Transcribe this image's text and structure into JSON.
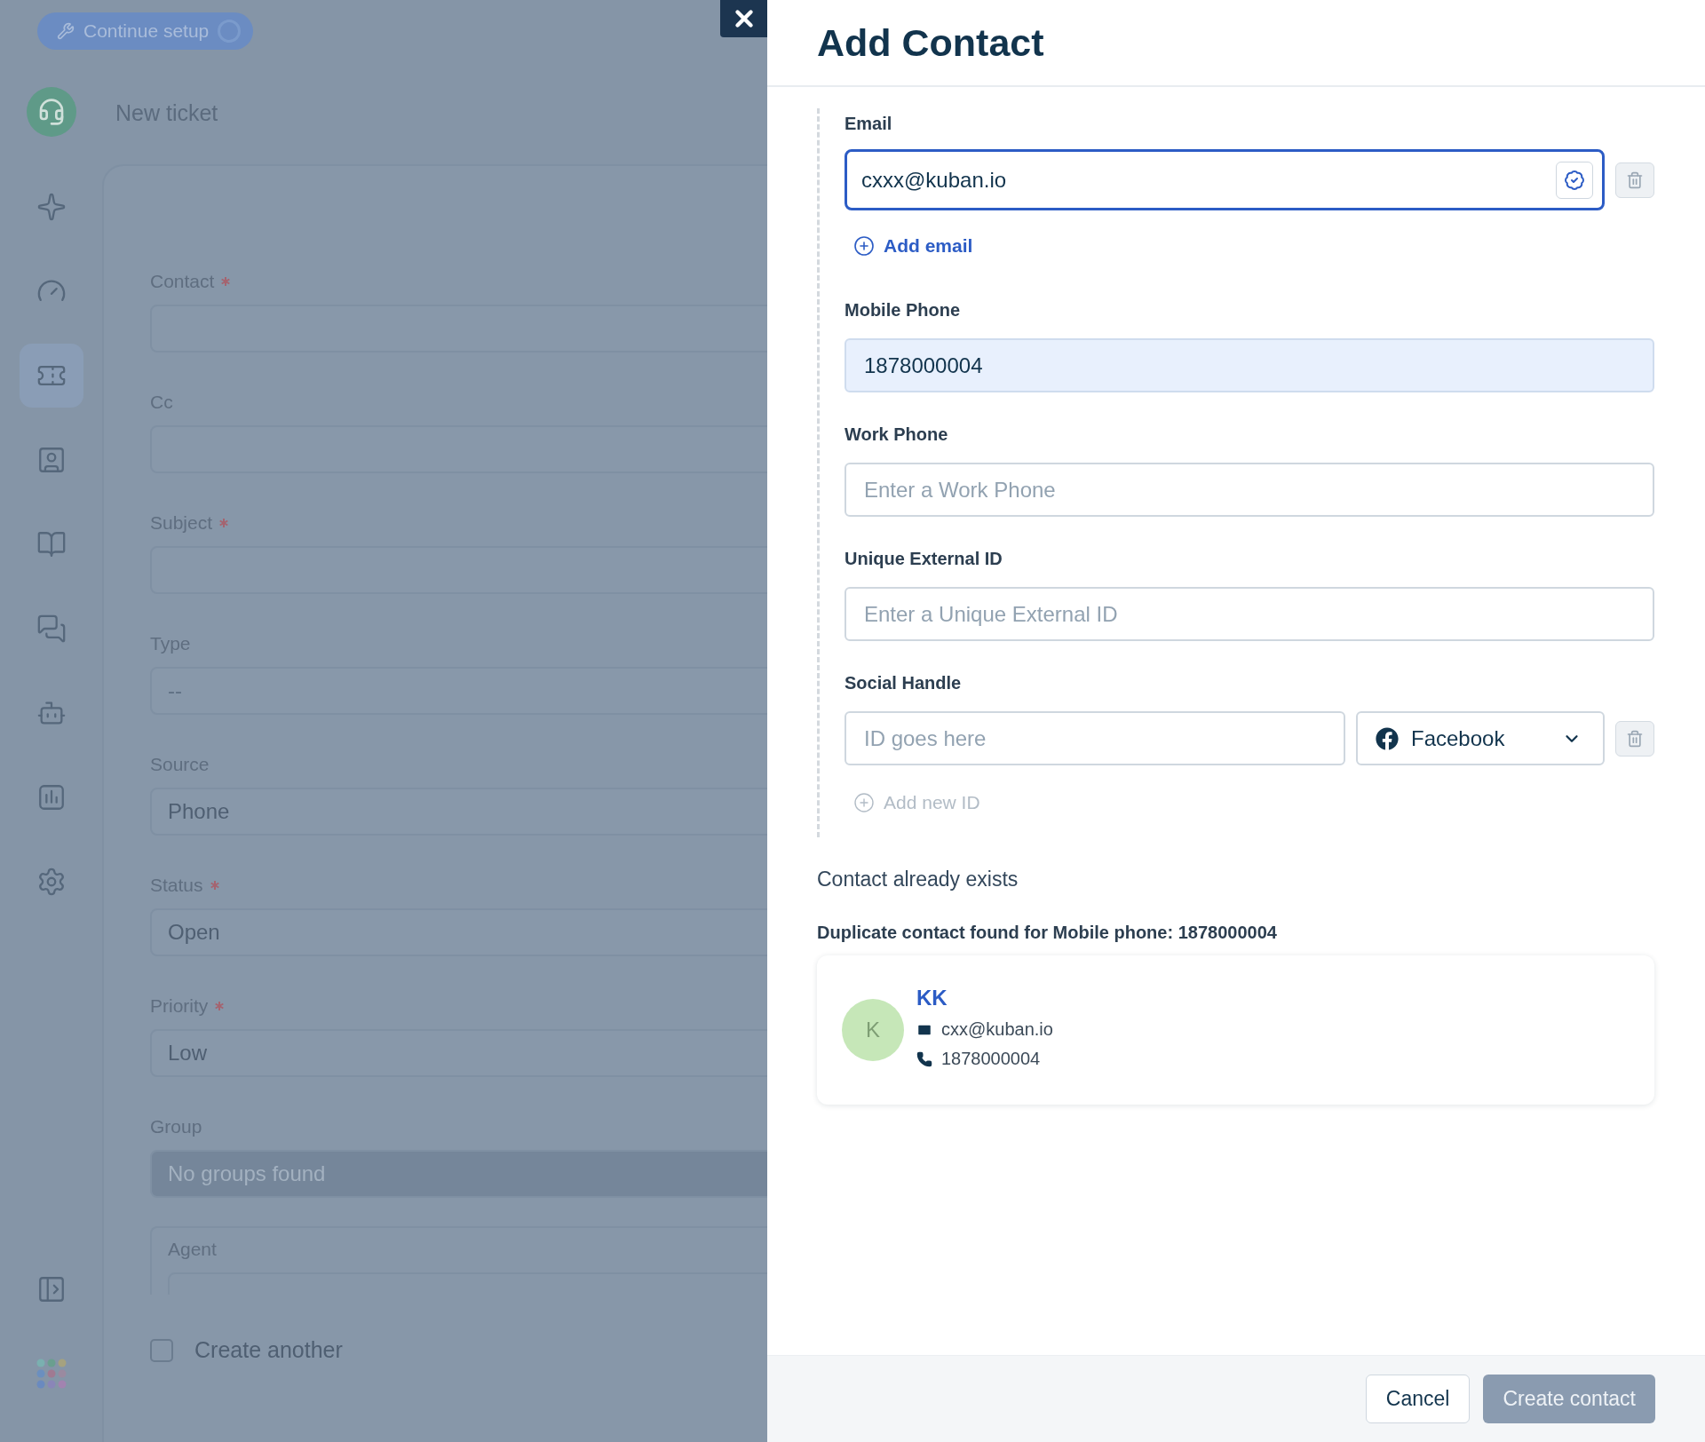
{
  "setup_button": {
    "label": "Continue setup"
  },
  "sidebar": {
    "items": [
      {
        "selected": false
      },
      {
        "selected": false
      },
      {
        "selected": true
      },
      {
        "selected": false
      },
      {
        "selected": false
      },
      {
        "selected": false
      },
      {
        "selected": false
      },
      {
        "selected": false
      },
      {
        "selected": false
      }
    ]
  },
  "ticket_form": {
    "title": "New ticket",
    "fields": [
      {
        "label": "Contact",
        "required": true,
        "disabled": false
      },
      {
        "label": "Cc",
        "required": false,
        "disabled": false
      },
      {
        "label": "Subject",
        "required": true,
        "disabled": false
      },
      {
        "label": "Type",
        "required": false,
        "disabled": false,
        "placeholder": "--"
      },
      {
        "label": "Source",
        "required": false,
        "disabled": false,
        "value": "Phone"
      },
      {
        "label": "Status",
        "required": true,
        "disabled": false,
        "value": "Open"
      },
      {
        "label": "Priority",
        "required": true,
        "disabled": false,
        "value": "Low"
      },
      {
        "label": "Group",
        "required": false,
        "disabled": true,
        "placeholder": "No groups found"
      }
    ],
    "agent": {
      "label": "Agent"
    },
    "create_another": {
      "label": "Create another",
      "checked": false
    }
  },
  "drawer": {
    "title": "Add Contact",
    "email": {
      "label": "Email",
      "value": "cxxx@kuban.io",
      "focused": true,
      "add_label": "Add email"
    },
    "fields": [
      {
        "label": "Mobile Phone",
        "value": "1878000004",
        "highlighted": true
      },
      {
        "label": "Work Phone",
        "placeholder": "Enter a Work Phone",
        "highlighted": false
      },
      {
        "label": "Unique External ID",
        "placeholder": "Enter a Unique External ID",
        "highlighted": false
      }
    ],
    "social": {
      "label": "Social Handle",
      "placeholder": "ID goes here",
      "network": "Facebook",
      "add_label": "Add new ID",
      "add_disabled": true
    },
    "duplicate": {
      "heading": "Contact already exists",
      "message": "Duplicate contact found for Mobile phone: 1878000004",
      "contact": {
        "initial": "K",
        "name": "KK",
        "email": "cxx@kuban.io",
        "phone": "1878000004"
      }
    },
    "buttons": [
      {
        "label": "Cancel",
        "kind": "secondary",
        "disabled": false
      },
      {
        "label": "Create contact",
        "kind": "primary",
        "disabled": true
      }
    ]
  }
}
